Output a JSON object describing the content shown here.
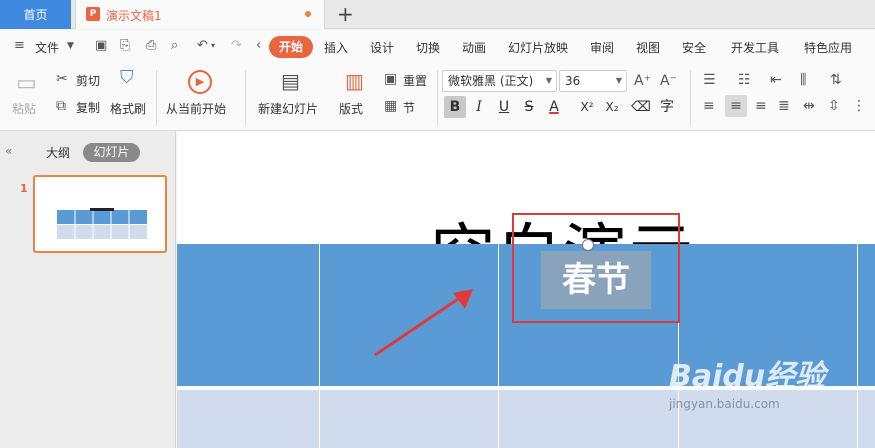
{
  "tabs": {
    "home": "首页",
    "doc_title": "演示文稿1",
    "new_tab": "+"
  },
  "menu": {
    "file": "文件",
    "items": [
      "开始",
      "插入",
      "设计",
      "切换",
      "动画",
      "幻灯片放映",
      "审阅",
      "视图",
      "安全",
      "开发工具",
      "特色应用"
    ]
  },
  "ribbon": {
    "paste": "粘贴",
    "cut": "剪切",
    "copy": "复制",
    "format_painter": "格式刷",
    "from_current": "从当前开始",
    "new_slide": "新建幻灯片",
    "layout": "版式",
    "reset": "重置",
    "section": "节",
    "font_name": "微软雅黑 (正文)",
    "font_size": "36",
    "bold": "B",
    "italic": "I",
    "underline": "U",
    "strike": "S",
    "font_color": "A",
    "superscript": "X²",
    "subscript": "X₂"
  },
  "panel": {
    "outline_tab": "大纲",
    "slides_tab": "幻灯片",
    "slide_number": "1"
  },
  "slide": {
    "title_text": "空白演示",
    "cell_text": "春节"
  },
  "watermark": {
    "logo": "Baidu经验",
    "site": "jingyan.baidu.com"
  },
  "colors": {
    "accent": "#e8653f",
    "home_tab": "#3f8ae0",
    "table_header": "#5b9bd5",
    "table_row": "#d0dcee",
    "selection": "#e0393a"
  }
}
